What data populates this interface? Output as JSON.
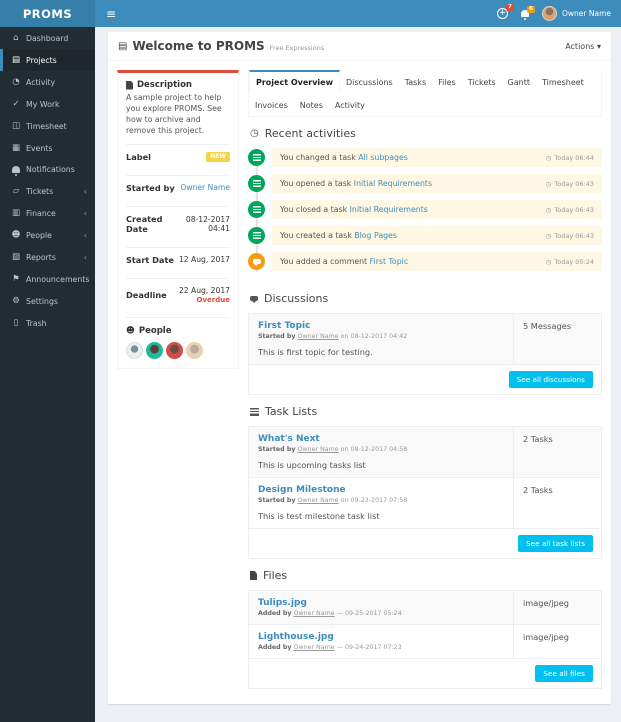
{
  "theme": {
    "navbar_color": "#3c8dbc",
    "logo_color": "#367fa9",
    "sidebar_color": "#222d32",
    "link_color": "#3c8dbc",
    "success_color": "#00a65a",
    "warning_color": "#f39c12",
    "danger_color": "#dd4b39",
    "info_button_color": "#00c0ef",
    "new_badge_color": "#f8d347",
    "activity_row_color": "#fdf7e3"
  },
  "icons": {
    "hamburger": "≡",
    "plus": "+",
    "caret_down": "▾",
    "chevron_left": "‹",
    "clock": "◷",
    "book": "▤",
    "people": "☻"
  },
  "navbar": {
    "brand": "PROMS",
    "add_badge_count": "7",
    "notification_badge_count": "6",
    "user_name": "Owner Name"
  },
  "sidebar": {
    "items": [
      {
        "label": "Dashboard",
        "glyph": "⌂"
      },
      {
        "label": "Projects",
        "glyph": "▤"
      },
      {
        "label": "Activity",
        "glyph": "◔"
      },
      {
        "label": "My Work",
        "glyph": "✓"
      },
      {
        "label": "Timesheet",
        "glyph": "◫"
      },
      {
        "label": "Events",
        "glyph": "▦"
      },
      {
        "label": "Notifications",
        "glyph": ""
      },
      {
        "label": "Tickets",
        "glyph": "▱",
        "chevron": "‹"
      },
      {
        "label": "Finance",
        "glyph": "▥",
        "chevron": "‹"
      },
      {
        "label": "People",
        "glyph": "☻",
        "chevron": "‹"
      },
      {
        "label": "Reports",
        "glyph": "▨",
        "chevron": "‹"
      },
      {
        "label": "Announcements",
        "glyph": "⚑"
      },
      {
        "label": "Settings",
        "glyph": "⚙"
      },
      {
        "label": "Trash",
        "glyph": "▯"
      }
    ]
  },
  "header": {
    "title": "Welcome to PROMS",
    "subtitle": "Free Expressions",
    "actions_label": "Actions"
  },
  "details": {
    "description_title": "Description",
    "description_text": "A sample project to help you explore PROMS. See how to archive and remove this project.",
    "label_title": "Label",
    "label_badge": "NEW",
    "started_by_title": "Started by",
    "started_by_value": "Owner Name",
    "created_title": "Created Date",
    "created_value": "08-12-2017 04:41",
    "start_title": "Start Date",
    "start_value": "12 Aug, 2017",
    "deadline_title": "Deadline",
    "deadline_value": "22 Aug, 2017",
    "deadline_flag": "Overdue",
    "people_title": "People"
  },
  "tabs": {
    "items": [
      {
        "label": "Project Overview"
      },
      {
        "label": "Discussions"
      },
      {
        "label": "Tasks"
      },
      {
        "label": "Files"
      },
      {
        "label": "Tickets"
      },
      {
        "label": "Gantt"
      },
      {
        "label": "Timesheet"
      },
      {
        "label": "Invoices"
      },
      {
        "label": "Notes"
      },
      {
        "label": "Activity"
      }
    ]
  },
  "activities": {
    "title": "Recent activities",
    "items": [
      {
        "prefix": "You changed a task",
        "link": "All subpages",
        "time": "Today 06:44"
      },
      {
        "prefix": "You opened a task",
        "link": "Initial Requirements",
        "time": "Today 06:43"
      },
      {
        "prefix": "You closed a task",
        "link": "Initial Requirements",
        "time": "Today 06:43"
      },
      {
        "prefix": "You created a task",
        "link": "Blog Pages",
        "time": "Today 06:43"
      },
      {
        "prefix": "You added a comment",
        "link": "First Topic",
        "time": "Today 05:24"
      }
    ]
  },
  "discussions": {
    "title": "Discussions",
    "see_all_label": "See all discussions",
    "rows": [
      {
        "name": "First Topic",
        "meta_prefix": "Started by",
        "meta_user": "Owner Name",
        "meta_rest": "on 08-12-2017 04:42",
        "body": "This is first topic for testing.",
        "count": "5 Messages"
      }
    ]
  },
  "tasklists": {
    "title": "Task Lists",
    "see_all_label": "See all task lists",
    "rows": [
      {
        "name": "What's Next",
        "meta_prefix": "Started by",
        "meta_user": "Owner Name",
        "meta_rest": "on 08-12-2017 04:58",
        "body": "This is upcoming tasks list",
        "count": "2 Tasks"
      },
      {
        "name": "Design Milestone",
        "meta_prefix": "Started by",
        "meta_user": "Owner Name",
        "meta_rest": "on 09-23-2017 07:58",
        "body": "This is test milestone task list",
        "count": "2 Tasks"
      }
    ]
  },
  "files": {
    "title": "Files",
    "see_all_label": "See all files",
    "rows": [
      {
        "name": "Tulips.jpg",
        "meta_prefix": "Added by",
        "meta_user": "Owner Name",
        "meta_rest": "— 09-25-2017 05:24",
        "count": "image/jpeg"
      },
      {
        "name": "Lighthouse.jpg",
        "meta_prefix": "Added by",
        "meta_user": "Owner Name",
        "meta_rest": "— 09-24-2017 07:23",
        "count": "image/jpeg"
      }
    ]
  }
}
